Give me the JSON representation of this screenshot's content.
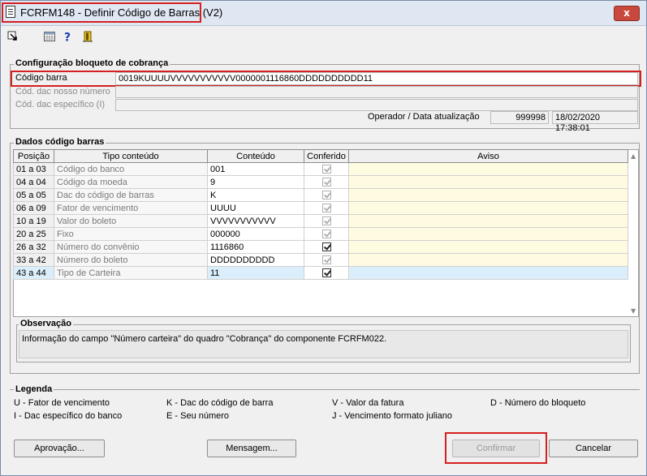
{
  "window": {
    "title": "FCRFM148 - Definir Código de Barras (V2)",
    "close_label": "x"
  },
  "config": {
    "title": "Configuração bloqueto de cobrança",
    "codigo_barra_label": "Código barra",
    "codigo_barra_value": "0019KUUUUVVVVVVVVVVV0000001116860DDDDDDDDDD11",
    "dac_nosso_label": "Cód. dac nosso número",
    "dac_especifico_label": "Cód. dac específico (I)",
    "operador_label": "Operador / Data atualização",
    "operador_value": "999998",
    "data_value": "18/02/2020 17:38:01"
  },
  "dados": {
    "title": "Dados código barras",
    "columns": [
      "Posição",
      "Tipo conteúdo",
      "Conteúdo",
      "Conferido",
      "Aviso"
    ],
    "rows": [
      {
        "pos": "01 a 03",
        "tipo": "Código do banco",
        "conteudo": "001",
        "conferido": false
      },
      {
        "pos": "04 a 04",
        "tipo": "Código da moeda",
        "conteudo": "9",
        "conferido": false
      },
      {
        "pos": "05 a 05",
        "tipo": "Dac do código de barras",
        "conteudo": "K",
        "conferido": false
      },
      {
        "pos": "06 a 09",
        "tipo": "Fator de vencimento",
        "conteudo": "UUUU",
        "conferido": false
      },
      {
        "pos": "10 a 19",
        "tipo": "Valor do boleto",
        "conteudo": "VVVVVVVVVVV",
        "conferido": false
      },
      {
        "pos": "20 a 25",
        "tipo": "Fixo",
        "conteudo": "000000",
        "conferido": false
      },
      {
        "pos": "26 a 32",
        "tipo": "Número do convênio",
        "conteudo": "1116860",
        "conferido": true
      },
      {
        "pos": "33 a 42",
        "tipo": "Número do boleto",
        "conteudo": "DDDDDDDDDD",
        "conferido": false
      },
      {
        "pos": "43 a 44",
        "tipo": "Tipo de Carteira",
        "conteudo": "11",
        "conferido": true
      }
    ],
    "observacao_title": "Observação",
    "observacao_text": "Informação do campo \"Número carteira\" do quadro \"Cobrança\" do componente FCRFM022."
  },
  "legenda": {
    "title": "Legenda",
    "items": [
      "U - Fator de vencimento",
      "K - Dac do código de barra",
      "V - Valor da fatura",
      "D - Número do bloqueto",
      "I - Dac específico do banco",
      "E - Seu número",
      "J - Vencimento formato juliano"
    ]
  },
  "buttons": {
    "aprovacao": "Aprovação...",
    "mensagem": "Mensagem...",
    "confirmar": "Confirmar",
    "cancelar": "Cancelar"
  },
  "colors": {
    "highlight_red": "#d42020",
    "aviso_bg": "#fffbe0",
    "selected_row": "#dbeefb"
  }
}
